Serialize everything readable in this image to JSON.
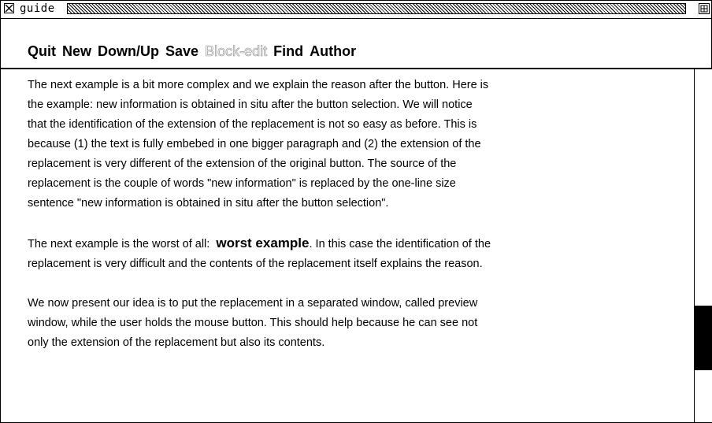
{
  "window": {
    "title": "guide"
  },
  "menu": {
    "quit": "Quit",
    "new": "New",
    "down_up": "Down/Up",
    "save": "Save",
    "block_edit": "Block-edit",
    "find": "Find",
    "author": "Author"
  },
  "content": {
    "p1": [
      "The next example is a bit more complex and we explain the reason after the button. Here is",
      "the example: new information is obtained  in situ after the button selection. We will notice",
      "that the identification of the extension of the replacement is not so easy as before. This is",
      "because (1) the text is fully embebed in one bigger paragraph and (2) the extension of the",
      "replacement is very different of the extension of the original button.   The source of the",
      "replacement is the couple of words \"new information\" is replaced by the one-line size",
      "sentence \"new information is obtained  in situ after the button selection\"."
    ],
    "p2_pre": "The next example is the worst of all:",
    "p2_button": "worst example",
    "p2_post": ".  In this case the identification of the",
    "p2_line2": "replacement is very difficult and the contents of the replacement  itself explains the reason.",
    "p3": [
      "We now present  our idea is to put the replacement in a separated window, called preview",
      "window,  while the user holds the mouse button.  This should help because he can see not",
      "only the extension of the replacement but also its contents."
    ]
  }
}
